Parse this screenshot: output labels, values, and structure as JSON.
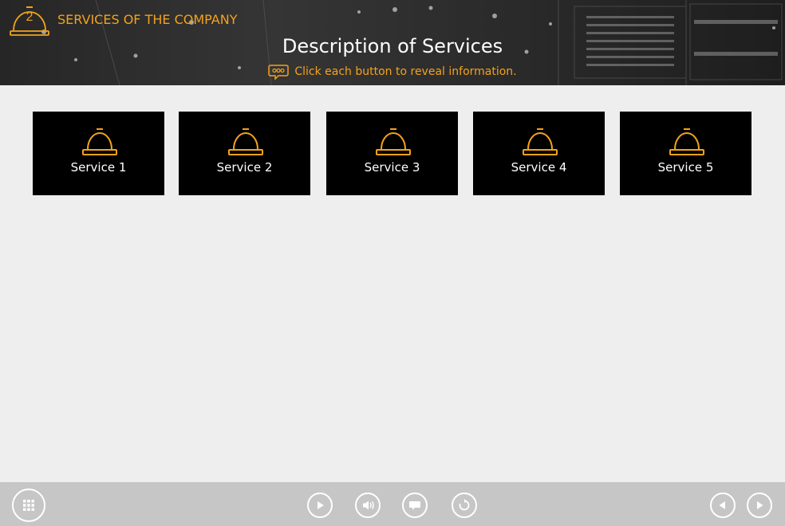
{
  "header": {
    "chapter_number": "2",
    "section_title": "SERVICES OF THE COMPANY",
    "page_title": "Description of Services",
    "instruction": "Click each button to reveal information."
  },
  "services": [
    {
      "label": "Service 1",
      "icon": "service-bell-icon"
    },
    {
      "label": "Service 2",
      "icon": "service-bell-icon"
    },
    {
      "label": "Service 3",
      "icon": "service-bell-icon"
    },
    {
      "label": "Service 4",
      "icon": "service-bell-icon"
    },
    {
      "label": "Service 5",
      "icon": "service-bell-icon"
    }
  ],
  "controls": {
    "left": [
      {
        "icon": "menu-grid-icon"
      }
    ],
    "center": [
      {
        "icon": "play-icon"
      },
      {
        "icon": "volume-icon"
      },
      {
        "icon": "captions-icon"
      },
      {
        "icon": "replay-icon"
      }
    ],
    "right": [
      {
        "icon": "previous-icon"
      },
      {
        "icon": "next-icon"
      }
    ]
  },
  "colors": {
    "accent": "#f3a21b",
    "header_background": "#2b2b2b",
    "tile_background": "#000000",
    "page_background": "#eeeeee",
    "bottom_bar": "#c6c6c6"
  }
}
